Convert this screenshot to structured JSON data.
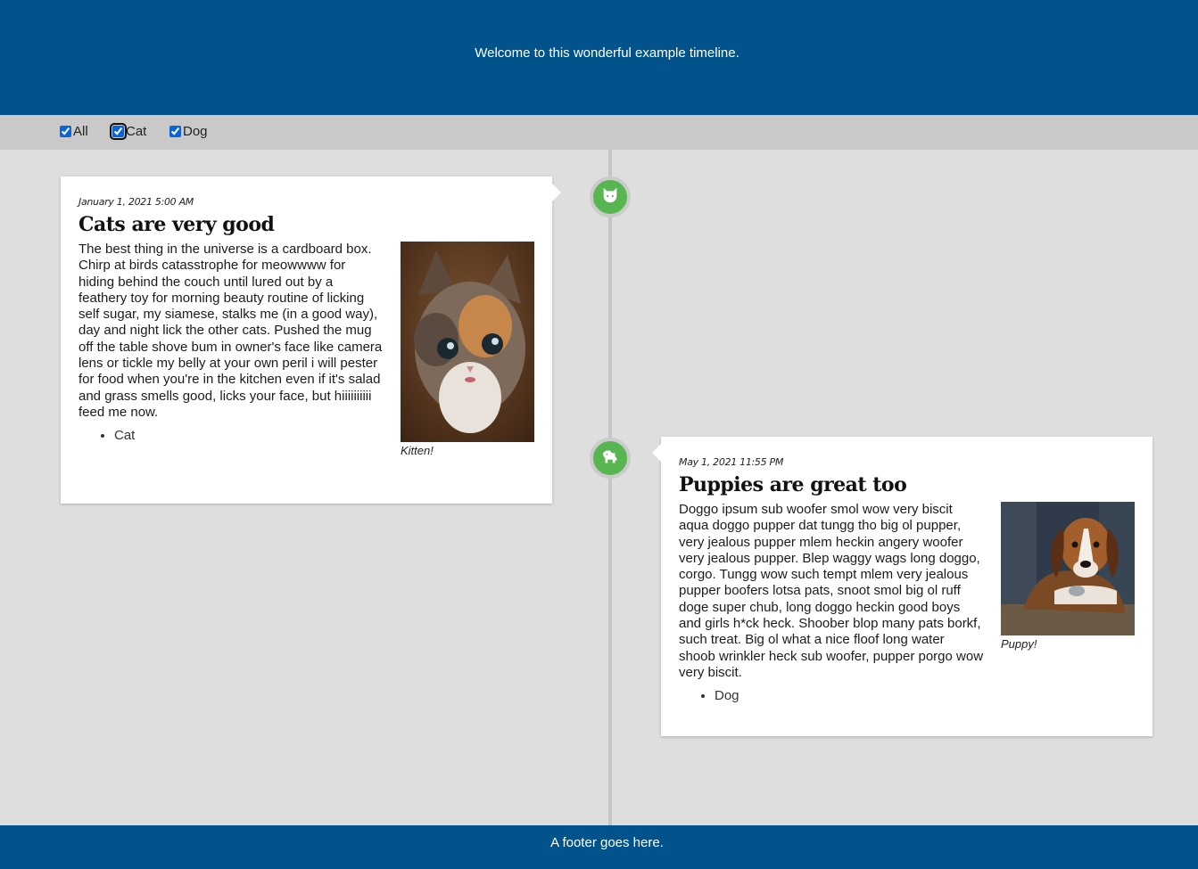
{
  "header": {
    "welcome": "Welcome to this wonderful example timeline."
  },
  "filters": [
    {
      "label": "All",
      "checked": true
    },
    {
      "label": "Cat",
      "checked": true
    },
    {
      "label": "Dog",
      "checked": true
    }
  ],
  "events": [
    {
      "date": "January 1, 2021 5:00 AM",
      "title": "Cats are very good",
      "body": "The best thing in the universe is a cardboard box. Chirp at birds catasstrophe for meowwww for hiding behind the couch until lured out by a feathery toy for morning beauty routine of licking self sugar, my siamese, stalks me (in a good way), day and night lick the other cats. Pushed the mug off the table shove bum in owner's face like camera lens or tickle my belly at your own peril i will pester for food when you're in the kitchen even if it's salad and grass smells good, licks your face, but hiiiiiiiiii feed me now.",
      "tag": "Cat",
      "image_caption": "Kitten!",
      "icon": "cat-icon"
    },
    {
      "date": "May 1, 2021 11:55 PM",
      "title": "Puppies are great too",
      "body": "Doggo ipsum sub woofer smol wow very biscit aqua doggo pupper dat tungg tho big ol pupper, very jealous pupper mlem heckin angery woofer very jealous pupper. Blep waggy wags long doggo, corgo. Tungg wow such tempt mlem very jealous pupper boofers lotsa pats, snoot smol big ol ruff doge super chub, long doggo heckin good boys and girls h*ck heck. Shoober blop many pats borkf, such treat. Big ol what a nice floof long water shoob wrinkler heck sub woofer, pupper porgo wow very biscit.",
      "tag": "Dog",
      "image_caption": "Puppy!",
      "icon": "dog-icon"
    }
  ],
  "footer": {
    "text": "A footer goes here."
  },
  "colors": {
    "header_bg": "#02538b",
    "node_green": "#58b651",
    "filterbar_bg": "#c9c9c9",
    "page_bg": "#dedede"
  }
}
